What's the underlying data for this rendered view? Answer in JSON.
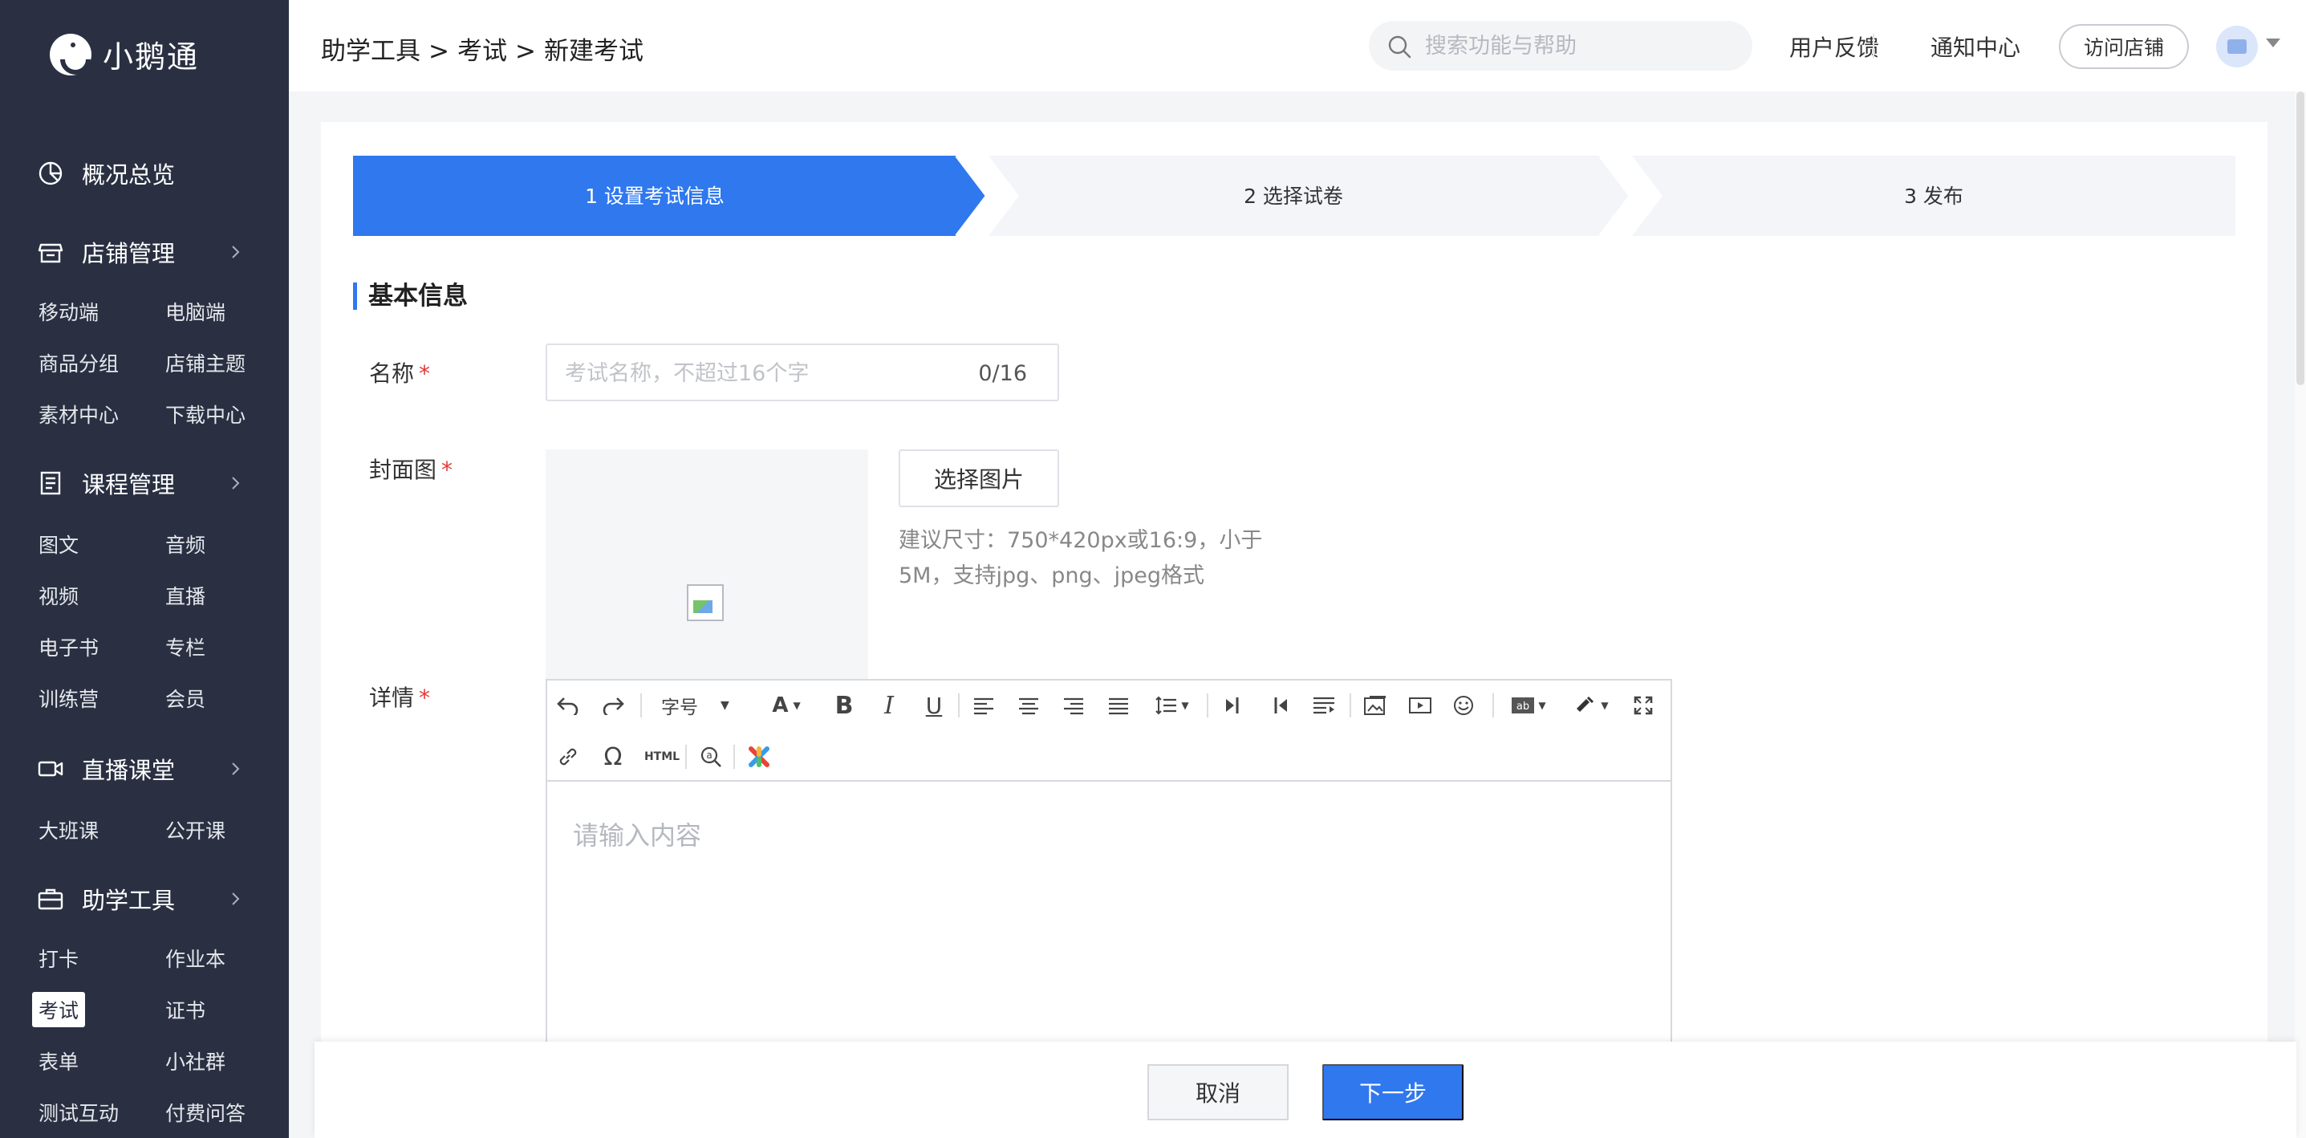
{
  "app": {
    "name": "小鹅通"
  },
  "sidebar": {
    "overview": "概况总览",
    "groups": [
      {
        "label": "店铺管理",
        "items": [
          "移动端",
          "电脑端",
          "商品分组",
          "店铺主题",
          "素材中心",
          "下载中心"
        ]
      },
      {
        "label": "课程管理",
        "items": [
          "图文",
          "音频",
          "视频",
          "直播",
          "电子书",
          "专栏",
          "训练营",
          "会员"
        ]
      },
      {
        "label": "直播课堂",
        "items": [
          "大班课",
          "公开课"
        ]
      },
      {
        "label": "助学工具",
        "items": [
          "打卡",
          "作业本",
          "考试",
          "证书",
          "表单",
          "小社群",
          "测试互动",
          "付费问答"
        ]
      }
    ],
    "active_item": "考试"
  },
  "header": {
    "breadcrumb": [
      "助学工具",
      "考试",
      "新建考试"
    ],
    "breadcrumb_sep": ">",
    "search_placeholder": "搜索功能与帮助",
    "links": [
      "用户反馈",
      "通知中心"
    ],
    "visit_store": "访问店铺"
  },
  "steps": [
    {
      "label": "1 设置考试信息",
      "active": true
    },
    {
      "label": "2 选择试卷",
      "active": false
    },
    {
      "label": "3 发布",
      "active": false
    }
  ],
  "form": {
    "section_title": "基本信息",
    "required_mark": "*",
    "name_label": "名称",
    "name_placeholder": "考试名称，不超过16个字",
    "name_value": "",
    "name_counter": "0/16",
    "cover_label": "封面图",
    "cover_button": "选择图片",
    "cover_hint": "建议尺寸：750*420px或16:9，小于5M，支持jpg、png、jpeg格式",
    "detail_label": "详情",
    "editor_placeholder": "请输入内容",
    "toolbar_font_size": "字号",
    "toolbar_html": "HTML"
  },
  "footer": {
    "cancel": "取消",
    "next": "下一步"
  },
  "colors": {
    "sidebar_bg": "#2a3042",
    "accent": "#2f78ee",
    "required": "#e03b3b",
    "step_inactive_bg": "#f3f5f9"
  }
}
